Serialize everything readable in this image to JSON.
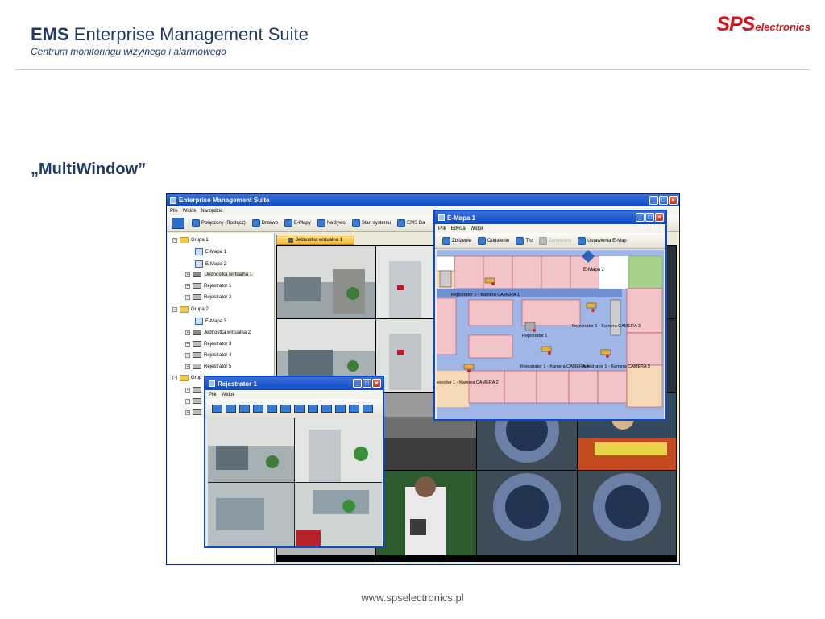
{
  "slide": {
    "title_bold": "EMS",
    "title_rest": " Enterprise Management Suite",
    "subtitle": "Centrum monitoringu wizyjnego i alarmowego",
    "logo_main": "SPS",
    "logo_sub": "electronics",
    "section_heading": "„MultiWindow”",
    "footer_url": "www.spselectronics.pl"
  },
  "app": {
    "title": "Enterprise Management Suite",
    "menu": [
      "Plik",
      "Widok",
      "Narzędzia"
    ],
    "toolbar": [
      "Połączony (Rozłącz)",
      "Drzewo",
      "E-Mapy",
      "Na żywo",
      "Stan systemu",
      "EMS Da"
    ],
    "tree": [
      {
        "label": "Grupa 1",
        "icon": "folder-icon",
        "expander": "−"
      },
      {
        "label": "E-Mapa 1",
        "icon": "map-icon"
      },
      {
        "label": "E-Mapa 2",
        "icon": "map-icon"
      },
      {
        "label": "Jednostka wirtualna 1",
        "icon": "virtual-unit-icon",
        "expander": "+",
        "selected": true
      },
      {
        "label": "Rejestrator 1",
        "icon": "recorder-icon",
        "expander": "+"
      },
      {
        "label": "Rejestrator 2",
        "icon": "recorder-icon",
        "expander": "+"
      },
      {
        "label": "Grupa 2",
        "icon": "folder-icon",
        "expander": "−"
      },
      {
        "label": "E-Mapa 3",
        "icon": "map-icon"
      },
      {
        "label": "Jednostka wirtualna 2",
        "icon": "virtual-unit-icon",
        "expander": "+"
      },
      {
        "label": "Rejestrator 3",
        "icon": "recorder-icon",
        "expander": "+"
      },
      {
        "label": "Rejestrator 4",
        "icon": "recorder-icon",
        "expander": "+"
      },
      {
        "label": "Rejestrator 5",
        "icon": "recorder-icon",
        "expander": "+"
      },
      {
        "label": "Grup",
        "icon": "folder-icon",
        "expander": "−"
      }
    ],
    "tab_label": "Jednostka wirtualna 1"
  },
  "rejestrator_window": {
    "title": "Rejestrator 1",
    "menu": [
      "Plik",
      "Widok"
    ]
  },
  "emap_window": {
    "title": "E-Mapa 1",
    "menu": [
      "Plik",
      "Edycja",
      "Widok"
    ],
    "toolbar": [
      "Zbliżenie",
      "Oddalenie",
      "Tło",
      "Zarejestruj",
      "Ustawienia E-Map"
    ],
    "map_labels": {
      "emapa2": "E-Mapa 2",
      "cam1": "Rejestrator 1 - Kamera CAMERA 1",
      "rec1": "Rejestrator 1",
      "cam3": "Rejestrator 1 - Kamera CAMERA 3",
      "cam4": "Rejestrator 1 - Kamera CAMERA 4",
      "cam5": "Rejestrator 1 - Kamera CAMERA 5",
      "cam2": "estrator 1 - Kamera CAMERA 2"
    }
  },
  "colors": {
    "slide_title": "#1f3864",
    "logo_red": "#d7121b",
    "titlebar_blue": "#0a4cc8",
    "tab_orange": "#f6b830"
  }
}
